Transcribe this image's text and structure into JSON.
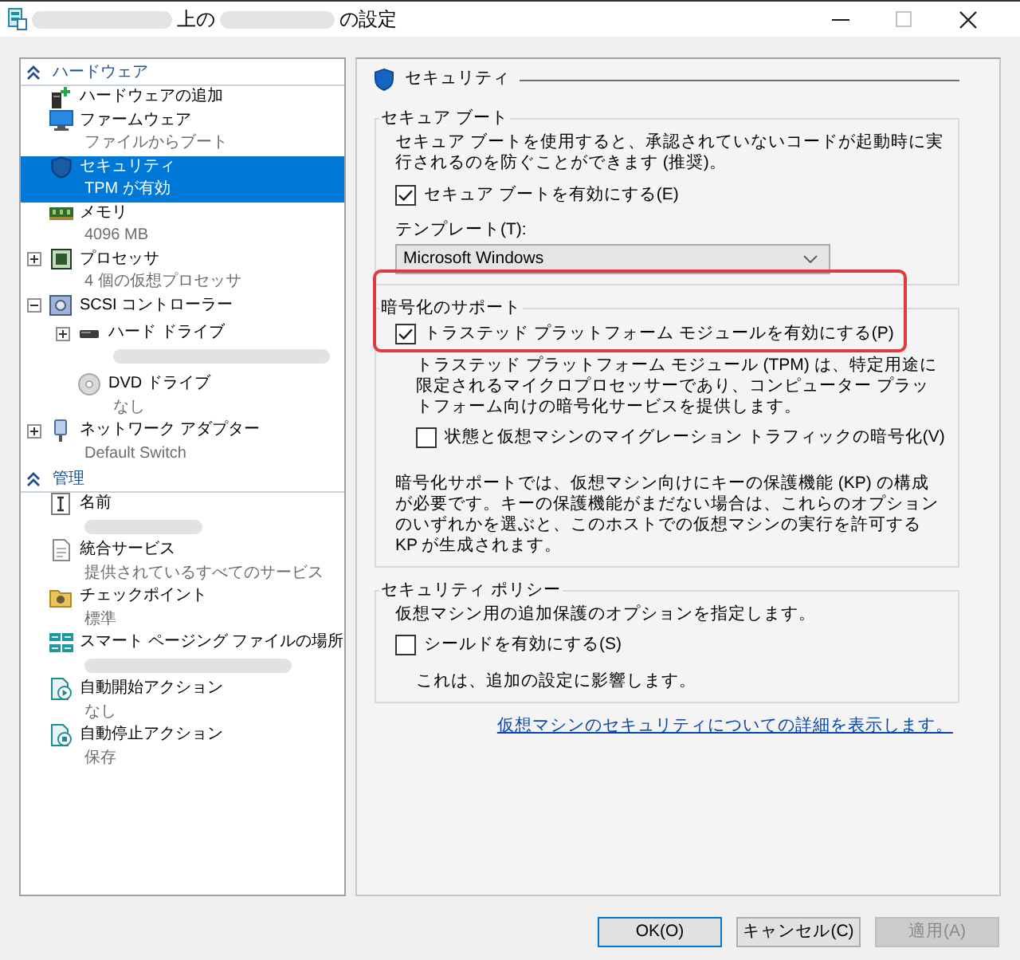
{
  "window": {
    "title_parts": [
      {
        "kind": "redacted"
      },
      {
        "kind": "text",
        "text": "上の"
      },
      {
        "kind": "redacted"
      },
      {
        "kind": "text",
        "text": "の設定"
      }
    ],
    "buttons": [
      {
        "kind": "minimize",
        "disabled": false
      },
      {
        "kind": "maximize",
        "disabled": true
      },
      {
        "kind": "close",
        "disabled": false
      }
    ]
  },
  "sidebar": {
    "sections": [
      {
        "label": "ハードウェア",
        "expanded": true,
        "items": [
          {
            "label": "ハードウェアの追加",
            "selected": false
          },
          {
            "label": "ファームウェア",
            "subtitle": "ファイルからブート",
            "selected": false
          },
          {
            "label": "セキュリティ",
            "subtitle": "TPM が有効",
            "selected": true
          },
          {
            "label": "メモリ",
            "subtitle": "4096 MB",
            "selected": false
          },
          {
            "label": "プロセッサ",
            "subtitle": "4 個の仮想プロセッサ",
            "selected": false,
            "expanded": false
          },
          {
            "label": "SCSI コントローラー",
            "selected": false,
            "expanded": true,
            "children": [
              {
                "label": "ハード ドライブ",
                "subtitle_redacted": true,
                "selected": false,
                "expanded": false
              },
              {
                "label": "DVD ドライブ",
                "subtitle": "なし",
                "selected": false
              }
            ]
          },
          {
            "label": "ネットワーク アダプター",
            "subtitle": "Default Switch",
            "selected": false,
            "expanded": false
          }
        ]
      },
      {
        "label": "管理",
        "expanded": true,
        "items": [
          {
            "label": "名前",
            "subtitle_redacted": true,
            "selected": false
          },
          {
            "label": "統合サービス",
            "subtitle": "提供されているすべてのサービス",
            "selected": false
          },
          {
            "label": "チェックポイント",
            "subtitle": "標準",
            "selected": false
          },
          {
            "label": "スマート ページング ファイルの場所",
            "subtitle_redacted": true,
            "selected": false
          },
          {
            "label": "自動開始アクション",
            "subtitle": "なし",
            "selected": false
          },
          {
            "label": "自動停止アクション",
            "subtitle": "保存",
            "selected": false
          }
        ]
      }
    ]
  },
  "panel": {
    "title": "セキュリティ",
    "groups": [
      {
        "title": "セキュア ブート",
        "highlighted": false,
        "items": [
          {
            "kind": "text",
            "text": "セキュア ブートを使用すると、承認されていないコードが起動時に実行されるのを防ぐことができます (推奨)。"
          },
          {
            "kind": "checkbox",
            "label": "セキュア ブートを有効にする(E)",
            "checked": true
          },
          {
            "kind": "label",
            "text": "テンプレート(T):"
          },
          {
            "kind": "dropdown",
            "value": "Microsoft Windows"
          }
        ]
      },
      {
        "title": "暗号化のサポート",
        "highlighted": true,
        "items": [
          {
            "kind": "checkbox",
            "label": "トラステッド プラットフォーム モジュールを有効にする(P)",
            "checked": true,
            "children": [
              {
                "kind": "text",
                "text": "トラステッド プラットフォーム モジュール (TPM) は、特定用途に限定されるマイクロプロセッサーであり、コンピューター プラットフォーム向けの暗号化サービスを提供します。"
              },
              {
                "kind": "checkbox",
                "label": "状態と仮想マシンのマイグレーション トラフィックの暗号化(V)",
                "checked": false
              }
            ]
          },
          {
            "kind": "text",
            "text": "暗号化サポートでは、仮想マシン向けにキーの保護機能 (KP) の構成が必要です。キーの保護機能がまだない場合は、これらのオプションのいずれかを選ぶと、このホストでの仮想マシンの実行を許可する KP が生成されます。"
          }
        ]
      },
      {
        "title": "セキュリティ ポリシー",
        "highlighted": false,
        "items": [
          {
            "kind": "text",
            "text": "仮想マシン用の追加保護のオプションを指定します。"
          },
          {
            "kind": "checkbox",
            "label": "シールドを有効にする(S)",
            "checked": false,
            "children": [
              {
                "kind": "text",
                "text": "これは、追加の設定に影響します。"
              }
            ]
          }
        ]
      }
    ],
    "link": "仮想マシンのセキュリティについての詳細を表示します。"
  },
  "dialog_buttons": [
    {
      "label": "OK(O)",
      "default": true,
      "disabled": false
    },
    {
      "label": "キャンセル(C)",
      "default": false,
      "disabled": false
    },
    {
      "label": "適用(A)",
      "default": false,
      "disabled": true
    }
  ]
}
